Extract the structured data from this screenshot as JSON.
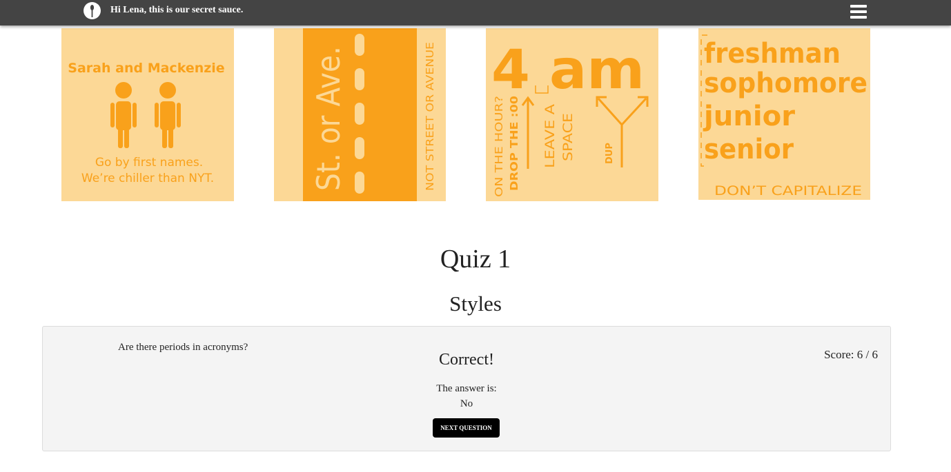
{
  "header": {
    "greeting": "Hi Lena, this is our secret sauce.",
    "logo_icon": "spoon-icon",
    "menu_icon": "hamburger-menu-icon"
  },
  "colors": {
    "header_bg": "#444444",
    "tile_bg": "#fcd896",
    "accent_orange": "#f9a11b",
    "panel_bg": "#f4f4f4",
    "button_bg": "#000000"
  },
  "tiles": [
    {
      "name": "Sarah and Mackenzie",
      "text1": "Go by first names.",
      "text2": "We’re chiller than NYT."
    },
    {
      "main": "St. or Ave.",
      "side": "NOT STREET OR AVENUE"
    },
    {
      "big": "4 am",
      "a": "ON THE HOUR?",
      "b": "DROP THE :00",
      "c": "LEAVE A",
      "d": "SPACE",
      "e": "DUP"
    },
    {
      "words": [
        "freshman",
        "sophomore",
        "junior",
        "senior"
      ],
      "caption": "DON’T CAPITALIZE"
    }
  ],
  "quiz": {
    "title": "Quiz 1",
    "section": "Styles",
    "question": "Are there periods in acronyms?",
    "result": "Correct!",
    "answer_label": "The answer is:",
    "answer": "No",
    "next_label": "NEXT QUESTION",
    "score": "Score: 6 / 6"
  }
}
